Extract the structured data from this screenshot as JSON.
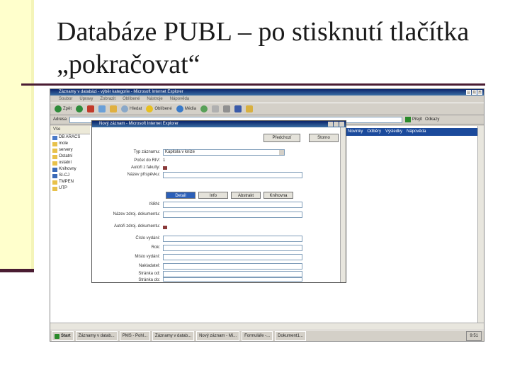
{
  "slide": {
    "title_line1": "Databáze PUBL – po stisknutí tlačítka",
    "title_line2": "„pokračovat“"
  },
  "browser": {
    "window_title": "Záznamy v databázi - výběr kategorie - Microsoft Internet Explorer",
    "menu": [
      "Soubor",
      "Úpravy",
      "Zobrazit",
      "Oblíbené",
      "Nástroje",
      "Nápověda"
    ],
    "toolbar": {
      "back": "Zpět",
      "search": "Hledat",
      "favorites": "Oblíbené",
      "media": "Média"
    },
    "address_label": "Adresa",
    "go_label": "Přejít",
    "links_label": "Odkazy"
  },
  "tree": {
    "header": "Vše",
    "items": [
      "DB ARACS",
      "mole",
      "servery",
      "Ostatní",
      "ostatní",
      "Knihovny",
      "SI-CJ",
      "TMPEN",
      "UTP"
    ]
  },
  "main": {
    "nav_band": [
      "Novinky",
      "Odběry",
      "Výsledky",
      "Nápověda"
    ]
  },
  "popup": {
    "title": "Nový záznam - Microsoft Internet Explorer",
    "buttons": {
      "predchozi": "Předchozí",
      "storno": "Storno"
    },
    "fields": {
      "druh_label": "Typ záznamu:",
      "druh_value": "Kapitola v knize",
      "pocet_label": "Počet do RIV:",
      "pocet_value": "1",
      "autor_label": "Autoři z fakulty:",
      "nazev_label": "Název příspěvku:"
    },
    "tabs": [
      "Detail",
      "Info",
      "Abstrakt",
      "Knihovna"
    ],
    "lower_fields": [
      "ISBN:",
      "Název zdroj. dokumentu:",
      "Autoři zdroj. dokumentu:",
      "Číslo vydání:",
      "Rok:",
      "Místo vydání:",
      "Nakladatel:",
      "Stránka od:",
      "Stránka do:"
    ]
  },
  "taskbar": {
    "start": "Start",
    "items": [
      "Záznamy v datab...",
      "PMS - Pohl...",
      "Záznamy v datab...",
      "Nový záznam - Mi...",
      "Formuláře -...",
      "Dokument1..."
    ],
    "clock": "9:51"
  },
  "colors": {
    "accent_dark": "#4a1c32",
    "band_blue": "#1b4a9c",
    "deco_yellow": "#ffffcc"
  }
}
